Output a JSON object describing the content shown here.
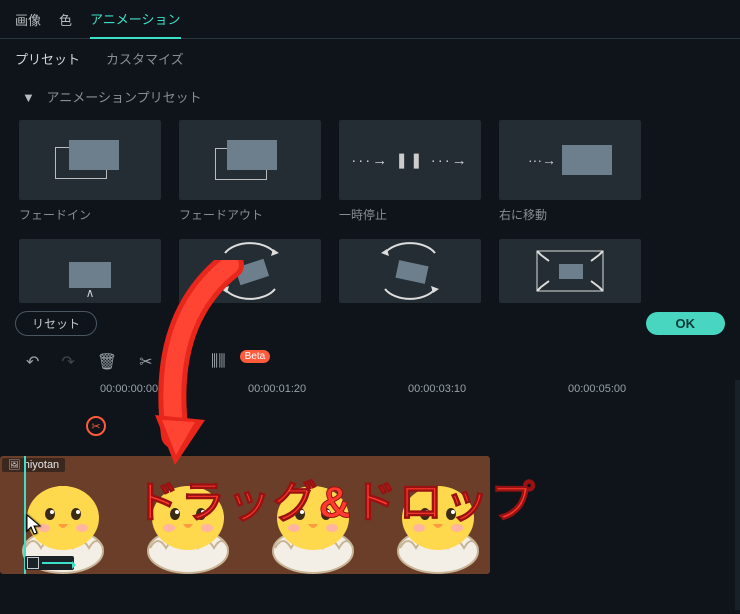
{
  "tabs": {
    "image": "画像",
    "color": "色",
    "animation": "アニメーション"
  },
  "subtabs": {
    "preset": "プリセット",
    "customize": "カスタマイズ"
  },
  "section_title": "アニメーションプリセット",
  "presets_row1": [
    {
      "label": "フェードイン"
    },
    {
      "label": "フェードアウト"
    },
    {
      "label": "一時停止"
    },
    {
      "label": "右に移動"
    }
  ],
  "footer": {
    "reset": "リセット",
    "ok": "OK"
  },
  "toolbar": {
    "beta": "Beta"
  },
  "timeline": {
    "marks": [
      "00:00:00:00",
      "00:00:01:20",
      "00:00:03:10",
      "00:00:05:00"
    ],
    "clip_name": "hiyotan",
    "track_badge": "1"
  },
  "overlay": "ドラッグ&ドロップ"
}
